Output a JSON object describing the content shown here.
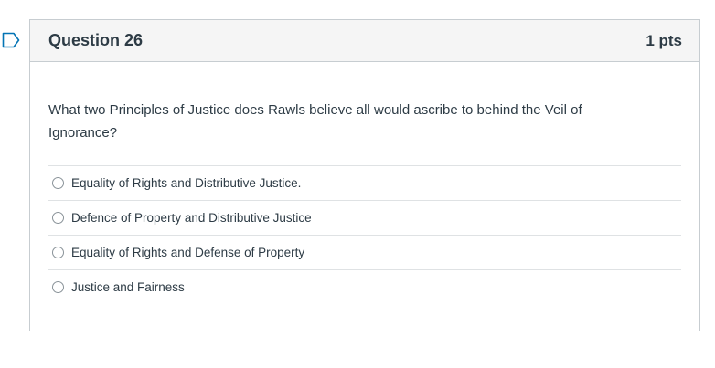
{
  "question": {
    "title": "Question 26",
    "points": "1 pts",
    "text": "What two Principles of Justice does Rawls believe all would ascribe to behind the Veil of Ignorance?",
    "answers": [
      {
        "label": "Equality of Rights and Distributive Justice.",
        "selected": false
      },
      {
        "label": "Defence of Property and Distributive Justice",
        "selected": false
      },
      {
        "label": "Equality of Rights and Defense of Property",
        "selected": false
      },
      {
        "label": "Justice and Fairness",
        "selected": false
      }
    ]
  },
  "icons": {
    "flag": "flag-outline-icon",
    "radio": "radio-unchecked-icon"
  },
  "colors": {
    "text": "#2d3b45",
    "header_bg": "#f5f5f5",
    "border": "#c7cdd1",
    "flag": "#0374b5"
  }
}
